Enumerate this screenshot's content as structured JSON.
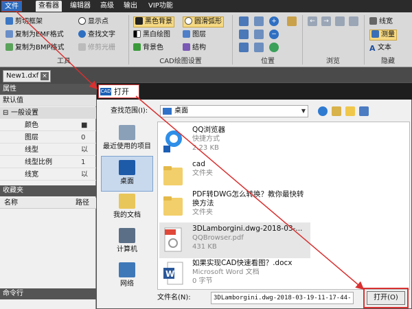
{
  "menu": {
    "tabs": [
      "文件",
      "查看器",
      "编辑器",
      "高级",
      "输出",
      "VIP功能"
    ]
  },
  "ribbon": {
    "tools": {
      "cut_frame": "剪切框架",
      "copy_emf": "复制为EMF格式",
      "copy_bmp": "复制为BMP格式",
      "show_point": "显示点",
      "find_text": "查找文字",
      "trim_raster": "修剪光栅",
      "label": "工具"
    },
    "cad_settings": {
      "black_bg": "黑色背景",
      "smooth_arc": "圆滑弧形",
      "bw_drawing": "黑白绘图",
      "layers": "图层",
      "bg_color": "背景色",
      "structure": "结构",
      "label": "CAD绘图设置"
    },
    "position_label": "位置",
    "browse_label": "浏览",
    "hide": {
      "linewidth": "线宽",
      "measure": "测量",
      "text": "文本",
      "label": "隐藏"
    }
  },
  "doc_tab": "New1.dxf",
  "left_panel": {
    "properties": "属性",
    "default": "默认值",
    "general": "一般设置",
    "rows": [
      {
        "k": "颜色",
        "v": "■"
      },
      {
        "k": "图层",
        "v": "0"
      },
      {
        "k": "线型",
        "v": "以"
      },
      {
        "k": "线型比例",
        "v": "1"
      },
      {
        "k": "线宽",
        "v": "以"
      }
    ],
    "favorites": "收藏夹",
    "col_name": "名称",
    "col_path": "路径",
    "command": "命令行"
  },
  "dialog": {
    "title": "打开",
    "look_in_label": "查找范围(I):",
    "look_in_value": "桌面",
    "places": [
      "最近使用的项目",
      "桌面",
      "我的文档",
      "计算机",
      "网络"
    ],
    "files": [
      {
        "name": "QQ浏览器",
        "type": "快捷方式",
        "size": "2.23 KB"
      },
      {
        "name": "cad",
        "type": "文件夹",
        "size": ""
      },
      {
        "name": "PDF转DWG怎么转换？教你最快转换方法",
        "type": "文件夹",
        "size": ""
      },
      {
        "name": "3DLamborgini.dwg-2018-03-...",
        "type": "QQBrowser.pdf",
        "size": "431 KB"
      },
      {
        "name": "如果实现CAD快速看图？.docx",
        "type": "Microsoft Word 文档",
        "size": "0 字节"
      }
    ],
    "filename_label": "文件名(N):",
    "filename_value": "3DLamborgini.dwg-2018-03-19-11-17-44-",
    "open_button": "打开(O)"
  }
}
